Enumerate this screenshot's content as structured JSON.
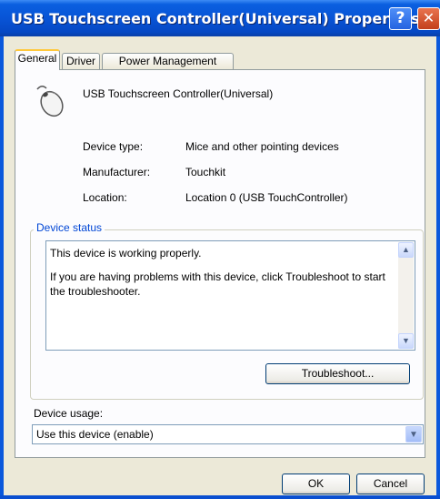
{
  "window": {
    "title": "USB Touchscreen Controller(Universal) Properties"
  },
  "tabs": [
    {
      "label": "General",
      "active": true
    },
    {
      "label": "Driver",
      "active": false
    },
    {
      "label": "Power Management",
      "active": false
    }
  ],
  "device": {
    "name": "USB Touchscreen Controller(Universal)",
    "icon": "mouse-icon",
    "properties": [
      {
        "label": "Device type:",
        "value": "Mice and other pointing devices"
      },
      {
        "label": "Manufacturer:",
        "value": "Touchkit"
      },
      {
        "label": "Location:",
        "value": "Location 0 (USB TouchController)"
      }
    ]
  },
  "status": {
    "group_label": "Device status",
    "line1": "This device is working properly.",
    "line2": "If you are having problems with this device, click Troubleshoot to start the troubleshooter.",
    "troubleshoot_label": "Troubleshoot..."
  },
  "usage": {
    "label": "Device usage:",
    "selected": "Use this device (enable)"
  },
  "buttons": {
    "ok": "OK",
    "cancel": "Cancel"
  },
  "colors": {
    "title_bar": "#0854d6",
    "dialog_bg": "#ece9d8",
    "group_title": "#0046d5",
    "close_button": "#c3401c"
  }
}
